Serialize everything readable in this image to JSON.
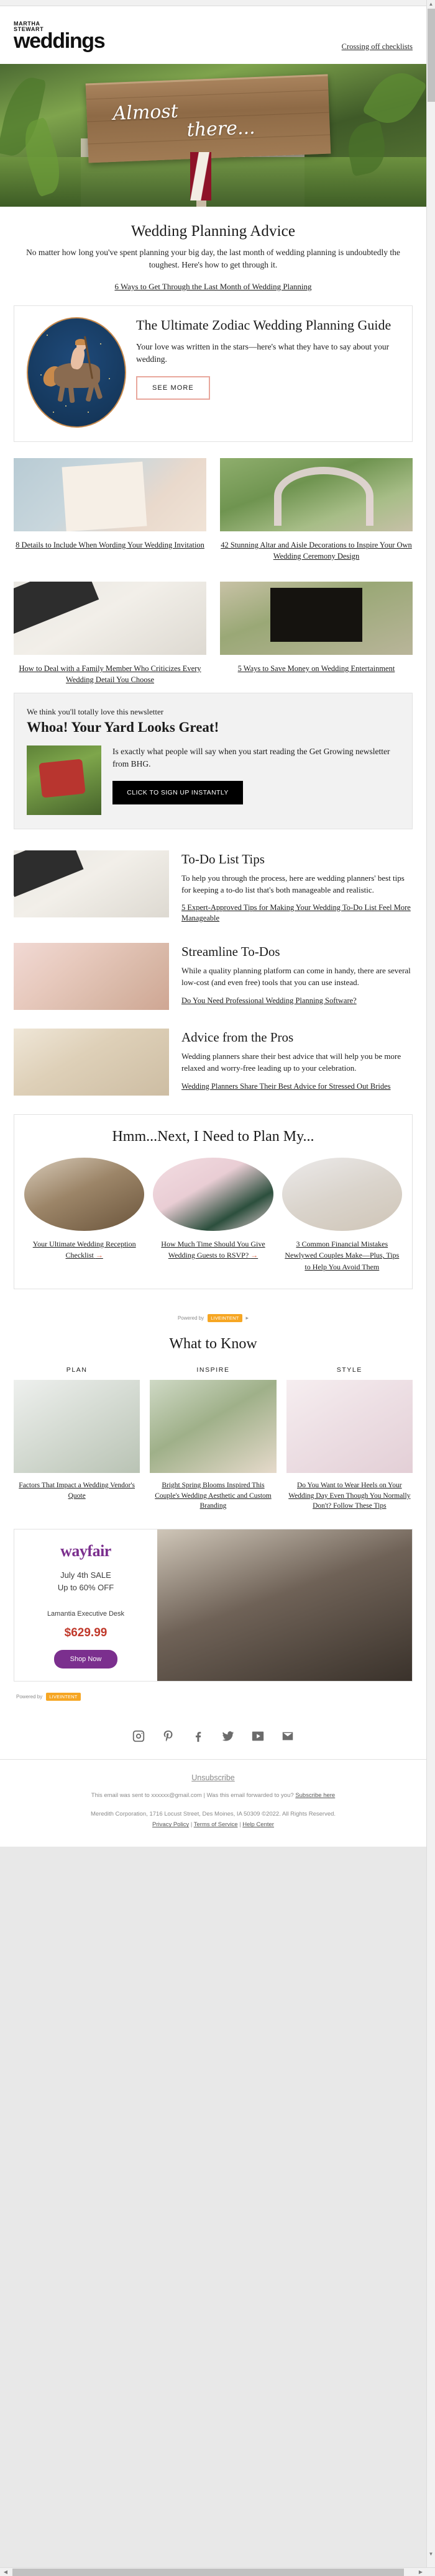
{
  "header": {
    "logo_line1": "MARTHA",
    "logo_line2": "STEWART",
    "logo_line3": "weddings",
    "preheader": "Crossing off checklists"
  },
  "hero": {
    "sign_line1": "Almost",
    "sign_line2": "there..."
  },
  "intro": {
    "title": "Wedding Planning Advice",
    "body": "No matter how long you've spent planning your big day, the last month of wedding planning is undoubtedly the toughest. Here's how to get through it.",
    "link": "6 Ways to Get Through the Last Month of Wedding Planning"
  },
  "zodiac_card": {
    "title": "The Ultimate Zodiac Wedding Planning Guide",
    "body": "Your love was written in the stars—here's what they have to say about your wedding.",
    "button": "SEE MORE"
  },
  "grid": [
    {
      "caption": "8 Details to Include When Wording Your Wedding Invitation",
      "image": "im-invite"
    },
    {
      "caption": "42 Stunning Altar and Aisle Decorations to Inspire Your Own Wedding Ceremony Design",
      "image": "im-altar"
    },
    {
      "caption": "How to Deal with a Family Member Who Criticizes Every Wedding Detail You Choose",
      "image": "im-desk"
    },
    {
      "caption": "5 Ways to Save Money on Wedding Entertainment",
      "image": "im-dj"
    }
  ],
  "bhg_ad": {
    "kicker": "We think you'll totally love this newsletter",
    "headline": "Whoa! Your Yard Looks Great!",
    "body": "Is exactly what people will say when you start reading the Get Growing newsletter from BHG.",
    "button": "CLICK TO SIGN UP INSTANTLY"
  },
  "rows": [
    {
      "title": "To-Do List Tips",
      "body": "To help you through the process, here are wedding planners' best tips for keeping a to-do list that's both manageable and realistic.",
      "link": "5 Expert-Approved Tips for Making Your Wedding To-Do List Feel More Manageable",
      "image": "im-desk"
    },
    {
      "title": "Streamline To-Dos",
      "body": "While a quality planning platform can come in handy, there are several low-cost (and even free) tools that you can use instead.",
      "link": "Do You Need Professional Wedding Planning Software?",
      "image": "im-toast"
    },
    {
      "title": "Advice from the Pros",
      "body": "Wedding planners share their best advice that will help you be more relaxed and worry-free leading up to your celebration.",
      "link": "Wedding Planners Share Their Best Advice for Stressed Out Brides",
      "image": "im-couple"
    }
  ],
  "plan_box": {
    "title": "Hmm...Next, I Need to Plan My...",
    "items": [
      {
        "label": "Your Ultimate Wedding Reception Checklist",
        "arrow": "→",
        "image": "im-recep"
      },
      {
        "label": "How Much Time Should You Give Wedding Guests to RSVP?",
        "arrow": "→",
        "image": "im-rsvp"
      },
      {
        "label": "3 Common Financial Mistakes Newlywed Couples Make—Plus, Tips to Help You Avoid Them",
        "arrow": "",
        "image": "im-coins"
      }
    ]
  },
  "powered_by": {
    "label": "Powered by",
    "badge": "LIVEINTENT",
    "mark": "AdChoices"
  },
  "what_to_know": {
    "title": "What to Know",
    "columns": [
      {
        "label": "PLAN",
        "link": "Factors That Impact a Wedding Vendor's Quote",
        "image": "im-vendor"
      },
      {
        "label": "INSPIRE",
        "link": "Bright Spring Blooms Inspired This Couple's Wedding Aesthetic and Custom Branding",
        "image": "im-blooms"
      },
      {
        "label": "STYLE",
        "link": "Do You Want to Wear Heels on Your Wedding Day Even Though You Normally Don't? Follow These Tips",
        "image": "im-heels"
      }
    ]
  },
  "wayfair_ad": {
    "brand": "wayfair",
    "sale_line1": "July 4th SALE",
    "sale_line2": "Up to 60% OFF",
    "product": "Lamantia Executive Desk",
    "price": "$629.99",
    "button": "Shop Now"
  },
  "footer": {
    "social": [
      "instagram",
      "pinterest",
      "facebook",
      "twitter",
      "youtube",
      "email"
    ],
    "unsubscribe": "Unsubscribe",
    "sent_to": "This email was sent to xxxxxx@gmail.com  |  Was this email forwarded to you?",
    "subscribe_link": "Subscribe here",
    "legal": "Meredith Corporation, 1716 Locust Street, Des Moines, IA 50309 ©2022. All Rights Reserved.",
    "links": [
      "Privacy Policy",
      "Terms of Service",
      "Help Center"
    ]
  }
}
